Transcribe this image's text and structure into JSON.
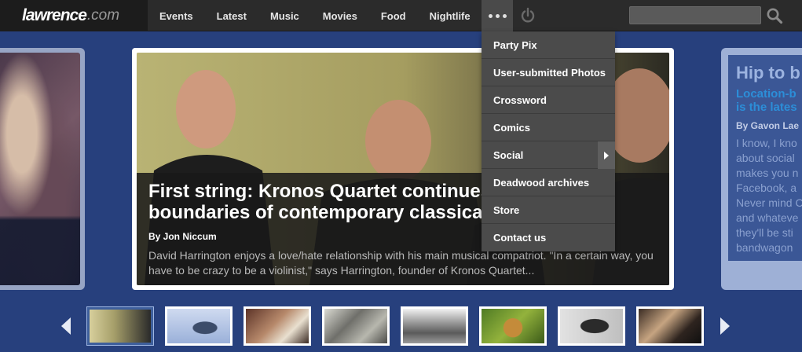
{
  "header": {
    "logo_main": "lawrence",
    "logo_tld": ".com",
    "nav": [
      "Events",
      "Latest",
      "Music",
      "Movies",
      "Food",
      "Nightlife"
    ],
    "search_placeholder": ""
  },
  "more_menu": {
    "items": [
      {
        "label": "Party Pix",
        "submenu": false
      },
      {
        "label": "User-submitted Photos",
        "submenu": false
      },
      {
        "label": "Crossword",
        "submenu": false
      },
      {
        "label": "Comics",
        "submenu": false
      },
      {
        "label": "Social",
        "submenu": true
      },
      {
        "label": "Deadwood archives",
        "submenu": false
      },
      {
        "label": "Store",
        "submenu": false
      },
      {
        "label": "Contact us",
        "submenu": false
      }
    ]
  },
  "feature": {
    "title": "First string: Kronos Quartet continues to push the boundaries of contemporary classical",
    "byline": "By Jon Niccum",
    "summary": "David Harrington enjoys a love/hate relationship with his main musical compatriot. \"In a certain way, you have to be crazy to be a violinist,\" says Harrington, founder of Kronos Quartet..."
  },
  "right_card": {
    "title": "Hip to b",
    "subtitle_lines": [
      "Location-b",
      "is the lates"
    ],
    "byline": "By Gavon Lae",
    "body_lines": [
      "I know, I kno",
      "about social",
      "makes you n",
      "Facebook, a",
      "Never mind C",
      "and whateve",
      "they'll be sti",
      "bandwagon"
    ]
  },
  "thumbnails": {
    "count": 8,
    "active_index": 0
  },
  "icons": {
    "more": "more-dots-icon",
    "power": "power-icon",
    "search": "search-icon",
    "prev": "chevron-left-icon",
    "next": "chevron-right-icon",
    "submenu": "chevron-right-icon"
  },
  "colors": {
    "page_background": "#27407d",
    "nav_background": "#2b2b2b",
    "dropdown_background": "#4b4b4b",
    "right_card_subtitle": "#2c8ed8"
  }
}
